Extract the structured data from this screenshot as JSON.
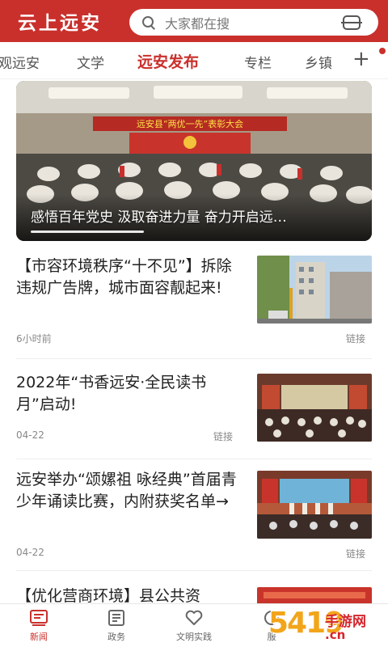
{
  "header": {
    "app_title": "云上远安",
    "search_placeholder": "大家都在搜"
  },
  "tabs": [
    {
      "label": "观远安",
      "active": false
    },
    {
      "label": "文学",
      "active": false
    },
    {
      "label": "远安发布",
      "active": true
    },
    {
      "label": "专栏",
      "active": false
    },
    {
      "label": "乡镇",
      "active": false
    }
  ],
  "tabs_more": "+",
  "hero": {
    "banner_text": "远安县“两优一先”表彰大会",
    "caption": "感悟百年党史 汲取奋进力量 奋力开启远…"
  },
  "news": [
    {
      "title": "【市容环境秩序“十不见”】拆除违规广告牌，城市面容靓起来!",
      "time": "6小时前",
      "tag": "链接"
    },
    {
      "title": "2022年“书香远安·全民读书月”启动!",
      "time": "04-22",
      "tag": "链接"
    },
    {
      "title": "远安举办“颂嫘祖 咏经典”首届青少年诵读比赛，内附获奖名单→",
      "time": "04-22",
      "tag": "链接"
    },
    {
      "title": "【优化营商环境】县公共资",
      "time": "",
      "tag": ""
    }
  ],
  "bottom_nav": [
    {
      "label": "新闻",
      "icon": "news-icon",
      "active": true
    },
    {
      "label": "政务",
      "icon": "government-icon",
      "active": false
    },
    {
      "label": "文明实践",
      "icon": "heart-icon",
      "active": false
    },
    {
      "label": "服",
      "icon": "service-icon",
      "active": false
    }
  ],
  "watermark": {
    "number": "5419",
    "text": "手游网",
    "url": ".cn"
  },
  "colors": {
    "brand_red": "#c9302c",
    "text": "#222222",
    "muted": "#888888"
  }
}
